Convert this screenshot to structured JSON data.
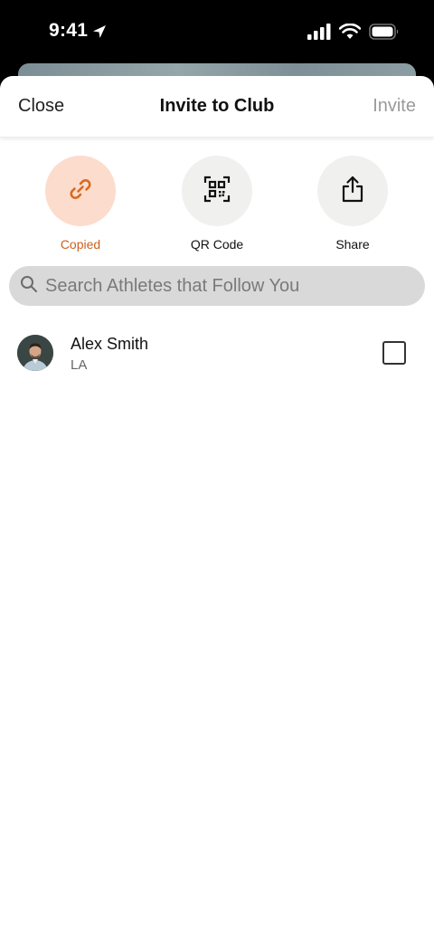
{
  "status_bar": {
    "time": "9:41",
    "icons": [
      "location-arrow-icon",
      "cellular-signal-icon",
      "wifi-icon",
      "battery-icon"
    ]
  },
  "nav": {
    "close_label": "Close",
    "title": "Invite to Club",
    "invite_label": "Invite"
  },
  "actions": [
    {
      "label": "Copied",
      "icon": "link-icon",
      "state": "copied"
    },
    {
      "label": "QR Code",
      "icon": "qr-code-icon"
    },
    {
      "label": "Share",
      "icon": "share-icon"
    }
  ],
  "search": {
    "placeholder": "Search Athletes that Follow You",
    "icon": "search-icon"
  },
  "athletes": [
    {
      "name": "Alex Smith",
      "city": "LA",
      "checked": false
    }
  ],
  "colors": {
    "accent": "#c8621f",
    "copied_bg": "#fcdccd",
    "invite_disabled": "#9a9a9a"
  }
}
